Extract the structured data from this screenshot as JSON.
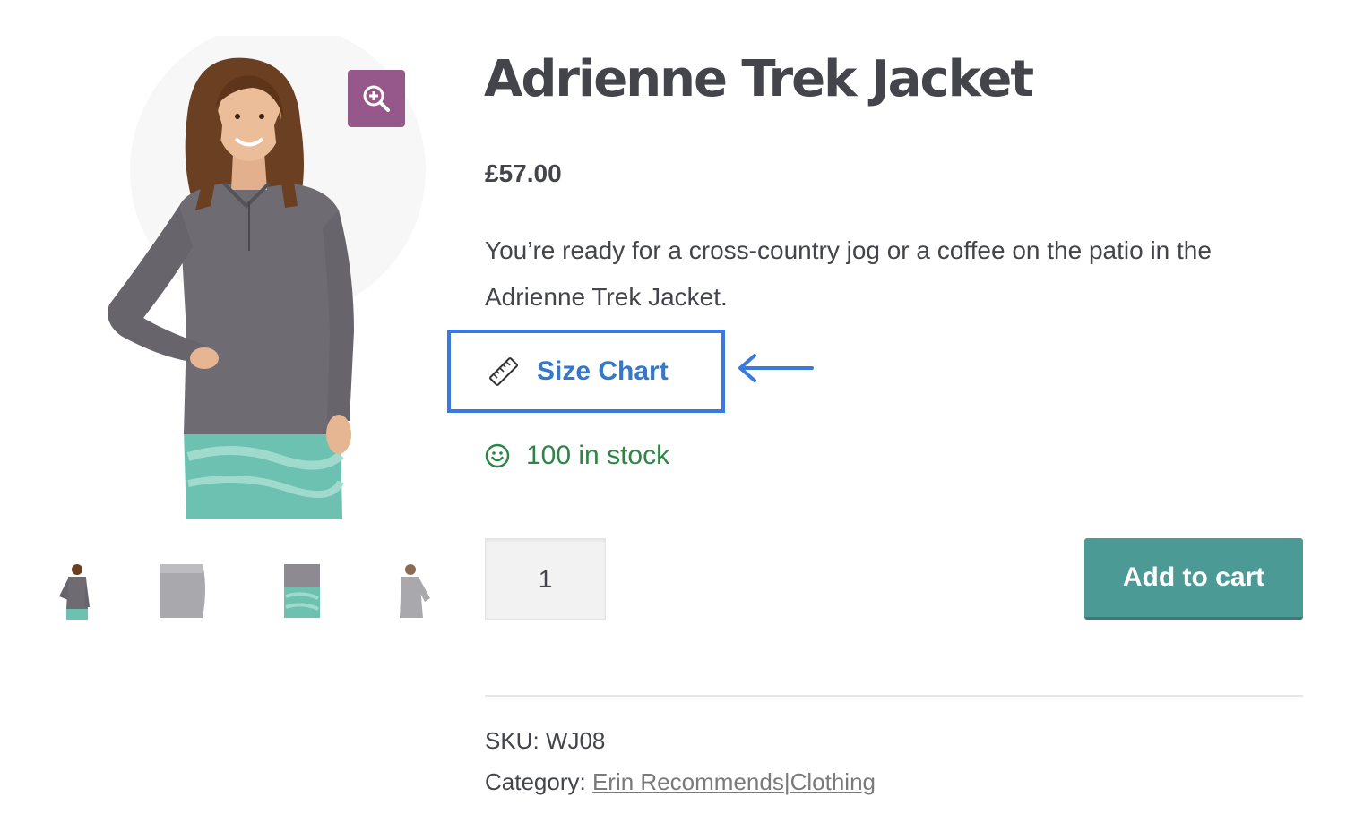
{
  "product": {
    "title": "Adrienne Trek Jacket",
    "price": "£57.00",
    "description": "You’re ready for a cross-country jog or a coffee on the patio in the Adrienne Trek Jacket.",
    "size_chart_label": "Size Chart",
    "stock_text": "100 in stock",
    "quantity": "1",
    "add_to_cart_label": "Add to cart",
    "sku_label": "SKU:",
    "sku_value": "WJ08",
    "category_label": "Category:",
    "categories": [
      "Erin Recommends",
      "Clothing"
    ],
    "category_separator": "|"
  },
  "icons": {
    "zoom": "zoom-in-icon",
    "ruler": "ruler-icon",
    "stock": "smiley-icon",
    "arrow": "arrow-left-icon"
  },
  "colors": {
    "zoom_button": "#96588a",
    "size_chart_border": "#3a7ae0",
    "size_chart_text": "#3577c9",
    "stock_text": "#2e8547",
    "cart_button": "#4c9a96"
  }
}
